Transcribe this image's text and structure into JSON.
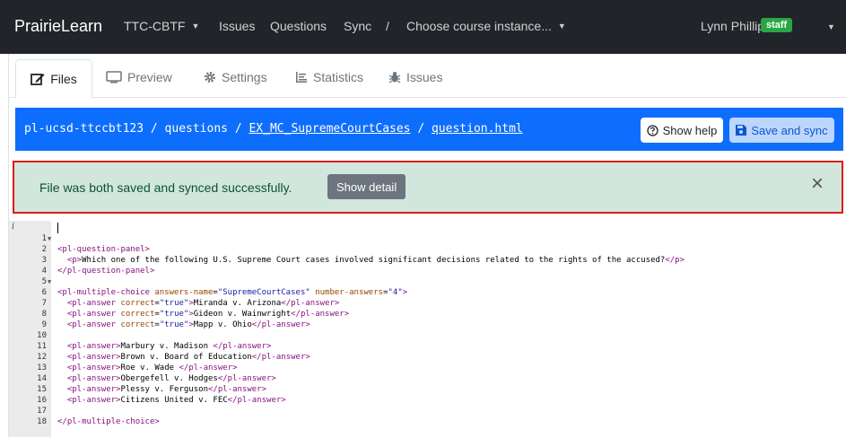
{
  "navbar": {
    "brand": "PrairieLearn",
    "course": "TTC-CBTF",
    "issues": "Issues",
    "questions": "Questions",
    "sync": "Sync",
    "separator": "/",
    "instance": "Choose course instance...",
    "user": "Lynn Phillips",
    "badge": "staff"
  },
  "tabs": [
    {
      "label": "Files",
      "icon": "edit-icon"
    },
    {
      "label": "Preview",
      "icon": "monitor-icon"
    },
    {
      "label": "Settings",
      "icon": "gear-icon"
    },
    {
      "label": "Statistics",
      "icon": "stats-icon"
    },
    {
      "label": "Issues",
      "icon": "bug-icon"
    }
  ],
  "path": {
    "root": "pl-ucsd-ttccbt123",
    "sep1": " / ",
    "questions": "questions",
    "sep2": " / ",
    "qid": "EX_MC_SupremeCourtCases",
    "sep3": " / ",
    "file": "question.html"
  },
  "buttons": {
    "help": "Show help",
    "save": "Save and sync"
  },
  "alert": {
    "message": "File was both saved and synced successfully.",
    "detail": "Show detail",
    "close": "×"
  },
  "colors": {
    "navbar": "#212529",
    "accent": "#0d6efd",
    "success_bg": "#d1e7dd",
    "highlight": "#e01b1b",
    "badge": "#28a745"
  },
  "editor": {
    "info": "i",
    "lines": [
      {
        "n": "1",
        "fold": true
      },
      {
        "n": "2"
      },
      {
        "n": "3"
      },
      {
        "n": "4"
      },
      {
        "n": "5",
        "fold": true
      },
      {
        "n": "6"
      },
      {
        "n": "7"
      },
      {
        "n": "8"
      },
      {
        "n": "9"
      },
      {
        "n": "10"
      },
      {
        "n": "11"
      },
      {
        "n": "12"
      },
      {
        "n": "13"
      },
      {
        "n": "14"
      },
      {
        "n": "15"
      },
      {
        "n": "16"
      },
      {
        "n": "17"
      },
      {
        "n": "18"
      }
    ],
    "code": {
      "l1_tag": "<pl-question-panel>",
      "l2_open": "<p>",
      "l2_text": "Which one of the following U.S. Supreme Court cases involved significant decisions related to the rights of the accused?",
      "l2_close": "</p>",
      "l3_tag": "</pl-question-panel>",
      "l5_open": "<pl-multiple-choice",
      "l5_attr1": "answers-name",
      "l5_val1": "\"SupremeCourtCases\"",
      "l5_attr2": "number-answers",
      "l5_val2": "\"4\"",
      "l5_close": ">",
      "ans_open": "<pl-answer",
      "attr_correct": "correct",
      "val_true": "\"true\"",
      "gt": ">",
      "eq": "=",
      "ans_tag": "<pl-answer>",
      "ans_close": "</pl-answer>",
      "a6": "Miranda v. Arizona",
      "a7": "Gideon v. Wainwright",
      "a8": "Mapp v. Ohio",
      "a10": "Marbury v. Madison ",
      "a11": "Brown v. Board of Education",
      "a12": "Roe v. Wade ",
      "a13": "Obergefell v. Hodges",
      "a14": "Plessy v. Ferguson",
      "a15": "Citizens United v. FEC",
      "l17_tag": "</pl-multiple-choice>"
    }
  }
}
